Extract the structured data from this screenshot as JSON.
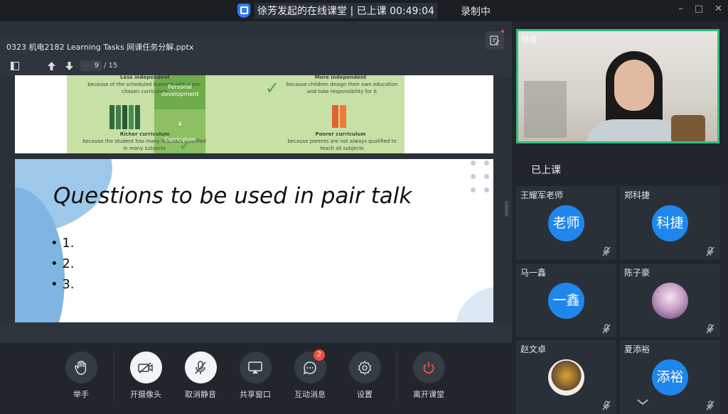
{
  "titlebar": {
    "class_title": "徐芳发起的在线课堂 | 已上课 00:49:04",
    "recording": "录制中",
    "minimize": "–",
    "maximize": "□",
    "close": "✕"
  },
  "document": {
    "file_name": "0323 机电2182 Learning Tasks 网课任务分解.pptx",
    "current_page": "9",
    "total_pages": "/ 15"
  },
  "slide_prev": {
    "less_independent": "Less independent",
    "less_desc": "because of the scheduled learning with a pre-chosen curriculum",
    "richer": "Richer curriculum",
    "richer_desc": "because the student has many teachers qualified in many subjects",
    "personal_dev": "Personal development",
    "num_4": "4",
    "curriculum": "Curriculum",
    "more_independent": "More independent",
    "more_desc": "because children design their own education and take responsibility for it",
    "poorer": "Poorer curriculum",
    "poorer_desc": "because parents are not always qualified to teach all subjects"
  },
  "slide_current": {
    "title": "Questions to be used in pair talk",
    "bullets": [
      "• 1.",
      "• 2.",
      "• 3."
    ]
  },
  "controls": {
    "raise_hand": "举手",
    "camera": "开摄像头",
    "unmute": "取消静音",
    "share": "共享窗口",
    "messages": "互动消息",
    "messages_badge": "2",
    "settings": "设置",
    "leave": "离开课堂"
  },
  "video": {
    "teacher_name": "徐芳"
  },
  "roster": {
    "status_title": "已上课",
    "participants": [
      {
        "name": "王耀军老师",
        "avatar_text": "老师"
      },
      {
        "name": "郑科捷",
        "avatar_text": "科捷"
      },
      {
        "name": "马一鑫",
        "avatar_text": "一鑫"
      },
      {
        "name": "陈子豪",
        "avatar_text": ""
      },
      {
        "name": "赵文卓",
        "avatar_text": ""
      },
      {
        "name": "夏添裕",
        "avatar_text": "添裕"
      }
    ]
  },
  "colors": {
    "accent": "#1f86ec",
    "active_speaker_border": "#34c07c",
    "badge": "#f24d3d",
    "leave": "#f1553c"
  }
}
